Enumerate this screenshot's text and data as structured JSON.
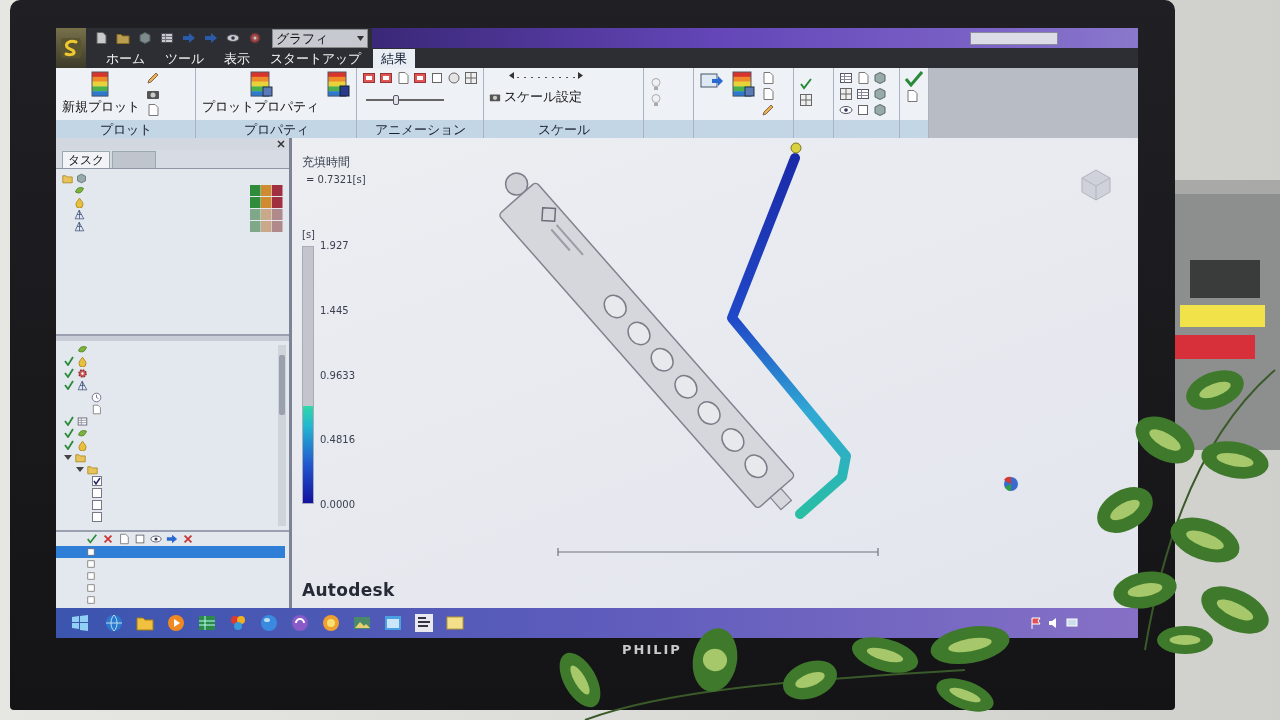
{
  "title_bar": {
    "view_combo": "グラフィ"
  },
  "ribbon": {
    "tabs": [
      {
        "label": "ホーム",
        "selected": false
      },
      {
        "label": "ツール",
        "selected": false
      },
      {
        "label": "表示",
        "selected": false
      },
      {
        "label": "スタートアップ",
        "selected": false
      },
      {
        "label": "結果",
        "selected": true
      }
    ],
    "groups": [
      {
        "kind": "plot",
        "label": "プロット",
        "button": "新規プロット"
      },
      {
        "kind": "properties",
        "label": "プロパティ",
        "button": "プロットプロパティ"
      },
      {
        "kind": "animation",
        "label": "アニメーション",
        "slider": {
          "level": 0.38
        }
      },
      {
        "kind": "scale",
        "label": "スケール",
        "button": "スケール設定"
      },
      {
        "kind": "view"
      },
      {
        "kind": "export"
      },
      {
        "kind": "check"
      },
      {
        "kind": "grid"
      },
      {
        "kind": "close"
      }
    ]
  },
  "tasks_panel": {
    "tabs": [
      {
        "label": "タスク",
        "selected": true
      },
      {
        "selected": false
      }
    ]
  },
  "study_tree": {
    "tasks": [
      {
        "done": false
      },
      {
        "done": true
      },
      {
        "done": true
      },
      {
        "done": true,
        "children": [
          {
            "done": false
          },
          {
            "done": false
          }
        ]
      },
      {
        "done": true
      },
      {
        "done": true
      },
      {
        "done": true
      }
    ],
    "results": {
      "expanded": true,
      "children": [
        {
          "expanded": true,
          "children": [
            {
              "checked": true
            },
            {
              "checked": false
            },
            {
              "checked": false
            },
            {
              "checked": false
            }
          ]
        }
      ]
    }
  },
  "layers_panel": {
    "rows": [
      {
        "selected": true
      },
      {
        "selected": false
      },
      {
        "selected": false
      },
      {
        "selected": false
      },
      {
        "selected": false
      }
    ]
  },
  "viewport": {
    "result_name": "充填時間",
    "result_value": "= 0.7321[s]",
    "legend": {
      "unit": "[s]",
      "ticks": [
        "1.927",
        "1.445",
        "0.9633",
        "0.4816",
        "0.0000"
      ],
      "level": 0.38
    },
    "logo": "Autodesk"
  },
  "monitor": {
    "brand": "PHILIP"
  }
}
